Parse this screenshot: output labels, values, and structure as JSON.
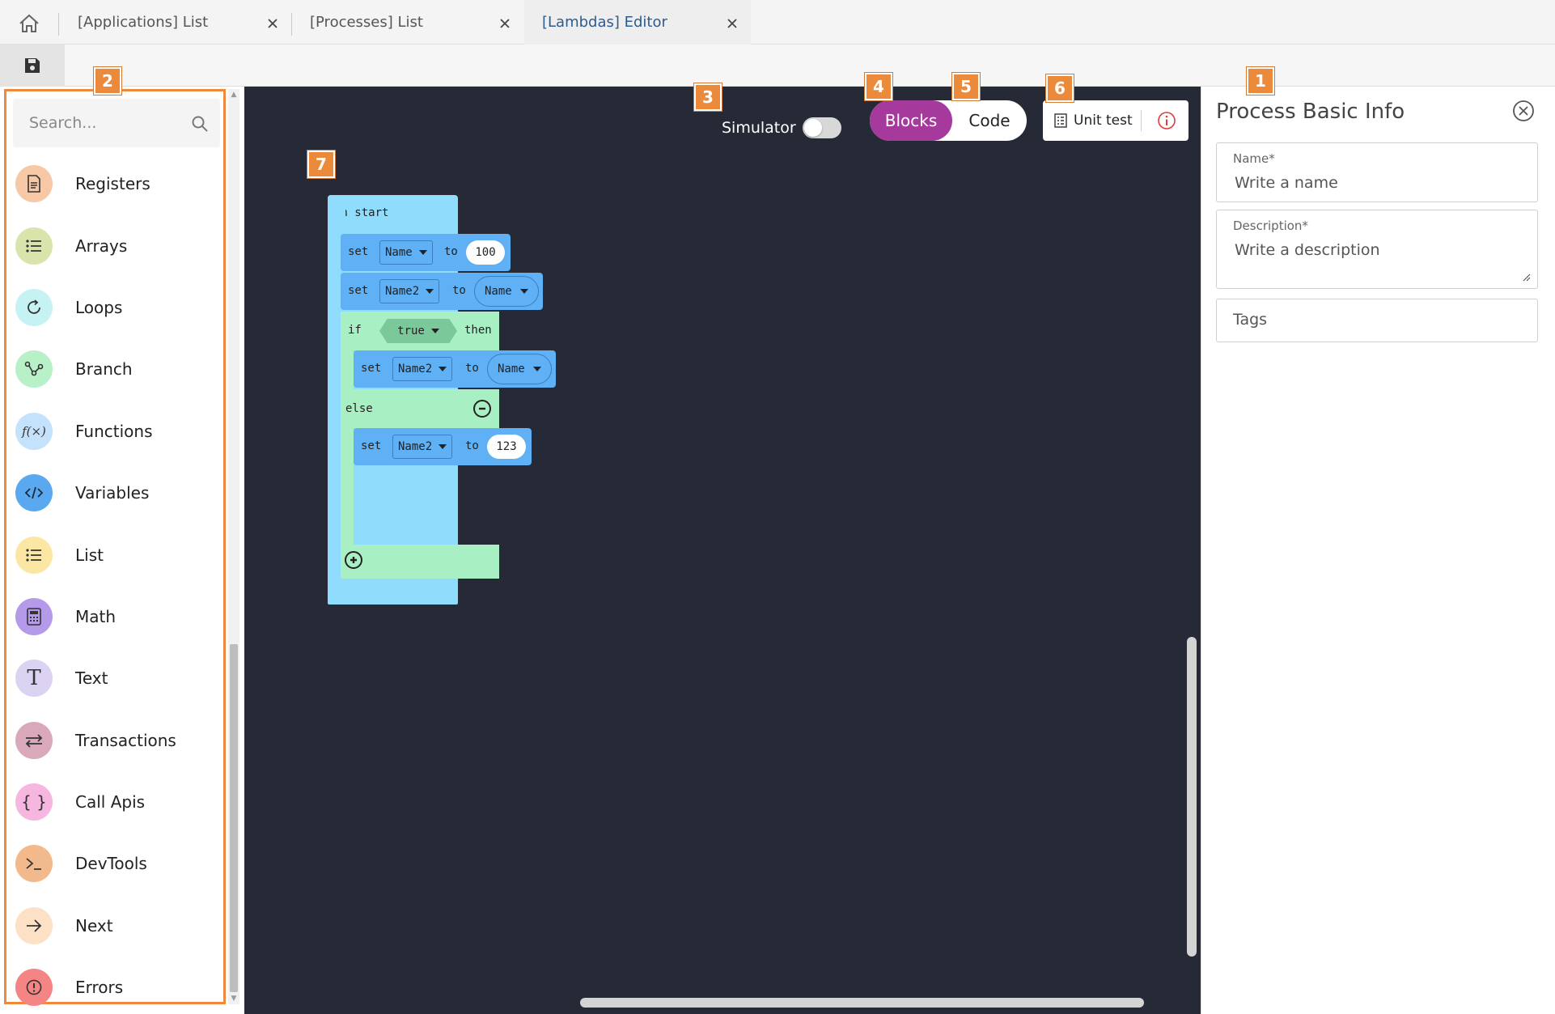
{
  "tabs": [
    {
      "label": "[Applications] List",
      "active": false
    },
    {
      "label": "[Processes] List",
      "active": false
    },
    {
      "label": "[Lambdas] Editor",
      "active": true
    }
  ],
  "sidebar": {
    "search_placeholder": "Search...",
    "categories": [
      {
        "label": "Registers",
        "icon": "document-icon",
        "color": "#f6c8a6"
      },
      {
        "label": "Arrays",
        "icon": "list-icon",
        "color": "#d9e4ac"
      },
      {
        "label": "Loops",
        "icon": "loop-icon",
        "color": "#c6f2f4"
      },
      {
        "label": "Branch",
        "icon": "branch-icon",
        "color": "#b8f0c8"
      },
      {
        "label": "Functions",
        "icon": "function-icon",
        "color": "#c4e2fb"
      },
      {
        "label": "Variables",
        "icon": "code-icon",
        "color": "#5aa9f0"
      },
      {
        "label": "List",
        "icon": "list-icon",
        "color": "#fbe7a3"
      },
      {
        "label": "Math",
        "icon": "calculator-icon",
        "color": "#b49ae8"
      },
      {
        "label": "Text",
        "icon": "text-icon",
        "color": "#dcd3f3"
      },
      {
        "label": "Transactions",
        "icon": "transfer-icon",
        "color": "#d9a9bb"
      },
      {
        "label": "Call Apis",
        "icon": "braces-icon",
        "color": "#f6b6e0"
      },
      {
        "label": "DevTools",
        "icon": "terminal-icon",
        "color": "#f2b98c"
      },
      {
        "label": "Next",
        "icon": "arrow-right-icon",
        "color": "#fde1c6"
      },
      {
        "label": "Errors",
        "icon": "error-icon",
        "color": "#f58585"
      }
    ]
  },
  "workspace": {
    "simulator_label": "Simulator",
    "blocks_label": "Blocks",
    "code_label": "Code",
    "unit_test_label": "Unit test",
    "blocks": {
      "on_start": "on start",
      "set": "set",
      "to": "to",
      "if": "if",
      "then": "then",
      "else": "else",
      "var_name": "Name",
      "var_name2": "Name2",
      "val_100": "100",
      "val_true": "true",
      "val_123": "123"
    }
  },
  "panel": {
    "title": "Process Basic Info",
    "name_label": "Name*",
    "name_placeholder": "Write a name",
    "desc_label": "Description*",
    "desc_placeholder": "Write a description",
    "tags_placeholder": "Tags"
  },
  "badges": {
    "b1": "1",
    "b2": "2",
    "b3": "3",
    "b4": "4",
    "b5": "5",
    "b6": "6",
    "b7": "7"
  },
  "colors": {
    "accent": "#a6399c",
    "badge": "#ec8a3c",
    "workspace_bg": "#252a36"
  }
}
